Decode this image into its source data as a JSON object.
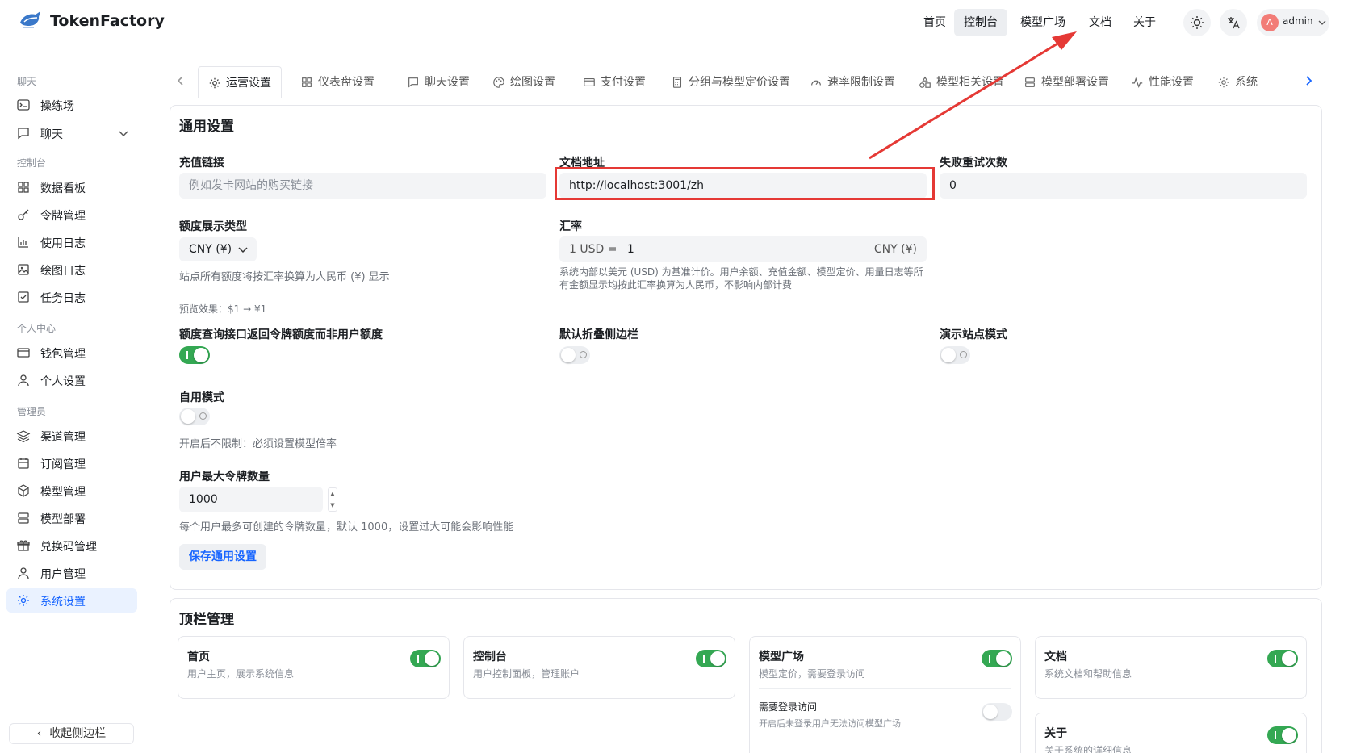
{
  "app": {
    "name": "TokenFactory"
  },
  "topnav": {
    "items": [
      {
        "label": "首页"
      },
      {
        "label": "控制台"
      },
      {
        "label": "模型广场"
      },
      {
        "label": "文档"
      },
      {
        "label": "关于"
      }
    ],
    "active": "控制台",
    "user": {
      "name": "admin",
      "avatar_letter": "A"
    }
  },
  "sidebar": {
    "groups": [
      "聊天",
      "控制台",
      "个人中心",
      "管理员"
    ],
    "items": [
      {
        "label": "操练场",
        "icon": "playground-icon"
      },
      {
        "label": "聊天",
        "icon": "chat-icon"
      },
      {
        "label": "数据看板",
        "icon": "dashboard-icon"
      },
      {
        "label": "令牌管理",
        "icon": "key-icon"
      },
      {
        "label": "使用日志",
        "icon": "bar-chart-icon"
      },
      {
        "label": "绘图日志",
        "icon": "image-icon"
      },
      {
        "label": "任务日志",
        "icon": "checkbox-icon"
      },
      {
        "label": "钱包管理",
        "icon": "wallet-icon"
      },
      {
        "label": "个人设置",
        "icon": "user-icon"
      },
      {
        "label": "渠道管理",
        "icon": "layers-icon"
      },
      {
        "label": "订阅管理",
        "icon": "calendar-icon"
      },
      {
        "label": "模型管理",
        "icon": "cube-icon"
      },
      {
        "label": "模型部署",
        "icon": "server-icon"
      },
      {
        "label": "兑换码管理",
        "icon": "gift-icon"
      },
      {
        "label": "用户管理",
        "icon": "user-icon"
      },
      {
        "label": "系统设置",
        "icon": "gear-icon"
      }
    ],
    "active": "系统设置",
    "collapse_label": "收起侧边栏"
  },
  "tabs": [
    {
      "label": "运营设置",
      "icon": "gear-icon"
    },
    {
      "label": "仪表盘设置",
      "icon": "grid-icon"
    },
    {
      "label": "聊天设置",
      "icon": "chat-icon"
    },
    {
      "label": "绘图设置",
      "icon": "palette-icon"
    },
    {
      "label": "支付设置",
      "icon": "card-icon"
    },
    {
      "label": "分组与模型定价设置",
      "icon": "calculator-icon"
    },
    {
      "label": "速率限制设置",
      "icon": "gauge-icon"
    },
    {
      "label": "模型相关设置",
      "icon": "shapes-icon"
    },
    {
      "label": "模型部署设置",
      "icon": "server-icon"
    },
    {
      "label": "性能设置",
      "icon": "activity-icon"
    },
    {
      "label": "系统",
      "icon": "gear-icon"
    }
  ],
  "general": {
    "title": "通用设置",
    "recharge_link": {
      "label": "充值链接",
      "placeholder": "例如发卡网站的购买链接"
    },
    "docs_url": {
      "label": "文档地址",
      "value": "http://localhost:3001/zh"
    },
    "retry_count": {
      "label": "失败重试次数",
      "value": "0"
    },
    "quota_display": {
      "label": "额度展示类型",
      "value": "CNY (¥)",
      "hint": "站点所有额度将按汇率换算为人民币 (¥) 显示",
      "preview": "预览效果：$1 → ¥1"
    },
    "exchange_rate": {
      "label": "汇率",
      "prefix": "1 USD =",
      "value": "1",
      "suffix": "CNY (¥)",
      "hint_line1": "系统内部以美元 (USD) 为基准计价。用户余额、充值金额、模型定价、用量日志等所",
      "hint_line2": "有金额显示均按此汇率换算为人民币，不影响内部计费"
    },
    "token_quota_toggle": {
      "label": "额度查询接口返回令牌额度而非用户额度",
      "on": true
    },
    "collapse_sidebar_toggle": {
      "label": "默认折叠侧边栏",
      "on": false
    },
    "demo_mode_toggle": {
      "label": "演示站点模式",
      "on": false
    },
    "self_use_mode": {
      "label": "自用模式",
      "on": false,
      "hint": "开启后不限制：必须设置模型倍率"
    },
    "max_tokens": {
      "label": "用户最大令牌数量",
      "value": "1000",
      "hint": "每个用户最多可创建的令牌数量，默认 1000，设置过大可能会影响性能"
    },
    "save_label": "保存通用设置"
  },
  "topbar_mgmt": {
    "title": "顶栏管理",
    "modules": [
      {
        "title": "首页",
        "desc": "用户主页，展示系统信息",
        "on": true
      },
      {
        "title": "控制台",
        "desc": "用户控制面板，管理账户",
        "on": true
      },
      {
        "title": "模型广场",
        "desc": "模型定价，需要登录访问",
        "on": true,
        "sub": {
          "title": "需要登录访问",
          "desc": "开启后未登录用户无法访问模型广场",
          "on": false
        }
      },
      {
        "title": "文档",
        "desc": "系统文档和帮助信息",
        "on": true
      },
      {
        "title": "关于",
        "desc": "关于系统的详细信息",
        "on": true
      }
    ]
  },
  "colors": {
    "accent": "#1664ff",
    "switch_on": "#34a853",
    "annotation": "#e53935"
  }
}
